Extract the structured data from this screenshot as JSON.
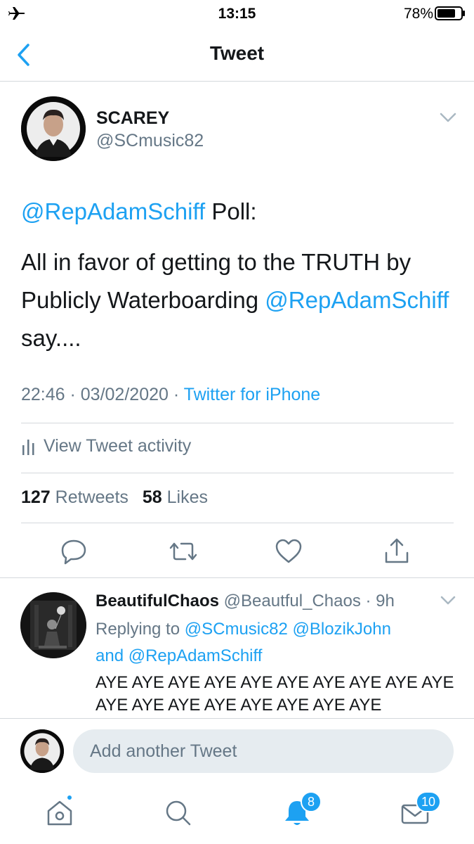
{
  "status_bar": {
    "time": "13:15",
    "battery_percent": "78%",
    "battery_level": 0.78
  },
  "nav": {
    "title": "Tweet"
  },
  "tweet": {
    "author_name": "SCAREY",
    "author_handle": "@SCmusic82",
    "line1_mention": "@RepAdamSchiff",
    "line1_text": " Poll:",
    "line2_text": "All in favor of getting to the TRUTH by Publicly Waterboarding ",
    "line2_mention": "@RepAdamSchiff",
    "line2_end": " say....",
    "timestamp": "22:46 · 03/02/2020 · ",
    "source": "Twitter for iPhone",
    "activity_label": "View Tweet activity",
    "retweets_count": "127",
    "retweets_label": "Retweets",
    "likes_count": "58",
    "likes_label": "Likes"
  },
  "reply": {
    "name": "BeautifulChaos",
    "handle_time": " @Beautful_Chaos · 9h",
    "replying_prefix": "Replying to ",
    "replying_mention1": "@SCmusic82",
    "replying_mention2": "@BlozikJohn",
    "replying_and": "and ",
    "replying_mention3": "@RepAdamSchiff",
    "text": "AYE AYE AYE AYE AYE AYE AYE AYE AYE AYE AYE AYE AYE AYE AYE AYE AYE AYE"
  },
  "compose": {
    "placeholder": "Add another Tweet"
  },
  "tabbar": {
    "notifications_badge": "8",
    "messages_badge": "10"
  },
  "colors": {
    "accent": "#1da1f2",
    "secondary_text": "#657786",
    "primary_text": "#14171a",
    "divider": "#d4d8dc"
  },
  "icons": {
    "status": [
      "airplane-icon",
      "battery-icon"
    ],
    "nav": [
      "back-chevron-icon"
    ],
    "actions": [
      "reply-icon",
      "retweet-icon",
      "like-icon",
      "share-icon"
    ],
    "tabs": [
      "home-icon",
      "search-icon",
      "bell-icon",
      "mail-icon"
    ]
  }
}
